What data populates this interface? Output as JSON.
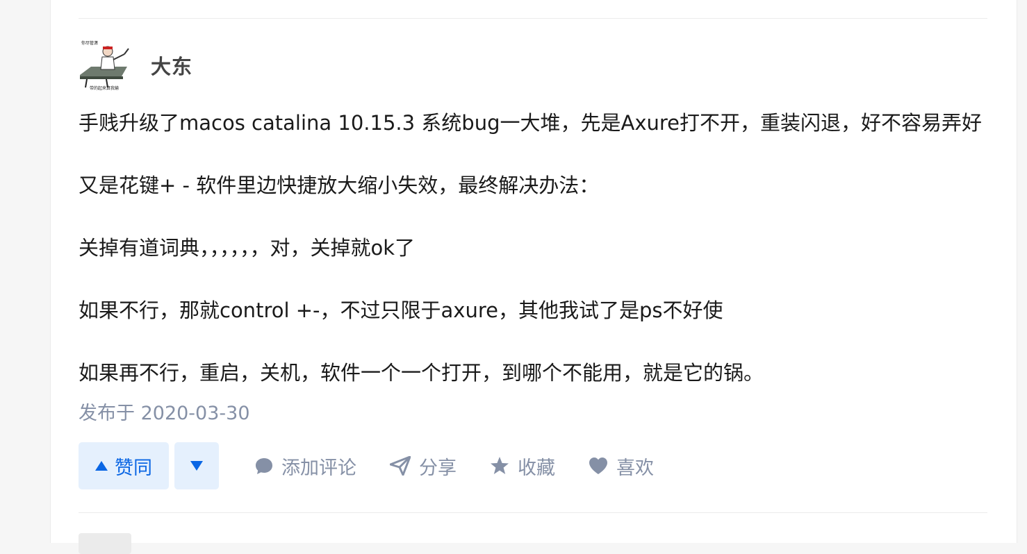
{
  "answer": {
    "author": {
      "name": "大东",
      "avatar_caption_top": "你尽管潇",
      "avatar_caption_bottom": "带的起来算我输"
    },
    "paragraphs": [
      "手贱升级了macos catalina 10.15.3 系统bug一大堆，先是Axure打不开，重装闪退，好不容易弄好",
      "又是花键+ - 软件里边快捷放大缩小失效，最终解决办法：",
      "关掉有道词典，，，，，，对，关掉就ok了",
      "如果不行，那就control +-，不过只限于axure，其他我试了是ps不好使",
      "如果再不行，重启，关机，软件一个一个打开，到哪个不能用，就是它的锅。"
    ],
    "publish_date": "发布于 2020-03-30"
  },
  "actions": {
    "vote_up_label": "赞同",
    "comment_label": "添加评论",
    "share_label": "分享",
    "favorite_label": "收藏",
    "like_label": "喜欢"
  },
  "icons": {
    "vote_up": "triangle-up-icon",
    "vote_down": "triangle-down-icon",
    "comment": "comment-bubble-icon",
    "share": "paper-plane-icon",
    "favorite": "star-icon",
    "like": "heart-icon"
  },
  "colors": {
    "accent": "#0a66e4",
    "vote_bg": "#e5f0fd",
    "meta_gray": "#8590a6",
    "text": "#1a1a1a"
  }
}
